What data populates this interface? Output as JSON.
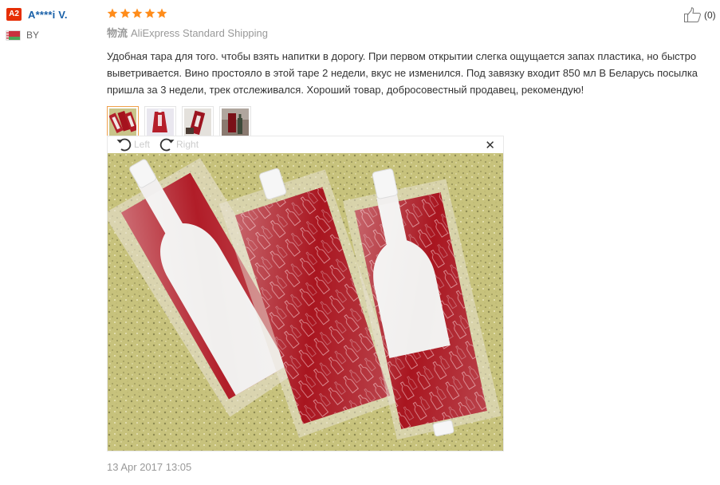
{
  "user": {
    "level_badge": "A2",
    "name": "A****i V.",
    "country": "BY",
    "flag_colors": {
      "red": "#c8313e",
      "green": "#4aa657"
    }
  },
  "review": {
    "stars": 5,
    "star_color": "#ff8c1a",
    "shipping_label": "物流",
    "shipping_method": "AliExpress Standard Shipping",
    "text": "Удобная тара для того. чтобы взять напитки в дорогу. При первом открытии слегка ощущается запах пластика, но быстро выветривается. Вино простояло в этой таре 2 недели, вкус не изменился. Под завязку входит 850 мл В Беларусь посылка пришла за 3 недели, трек отслеживался. Хороший товар, добросовестный продавец, рекомендую!",
    "thumbnails": [
      {
        "icon": "photo-thumbnail-three-bags",
        "active": true
      },
      {
        "icon": "photo-thumbnail-red-bag",
        "active": false
      },
      {
        "icon": "photo-thumbnail-bag-angled",
        "active": false
      },
      {
        "icon": "photo-thumbnail-bag-with-bottle",
        "active": false
      }
    ],
    "date": "13 Apr 2017 13:05"
  },
  "viewer": {
    "rotate_left_label": "Left",
    "rotate_right_label": "Right",
    "close_glyph": "✕",
    "photo_icon": "photo-red-wine-bags-on-granite"
  },
  "like": {
    "count": "(0)"
  },
  "colors": {
    "accent_orange": "#f0a04b",
    "link_blue": "#1960a8",
    "badge_red": "#e62e04",
    "muted": "#999999"
  }
}
